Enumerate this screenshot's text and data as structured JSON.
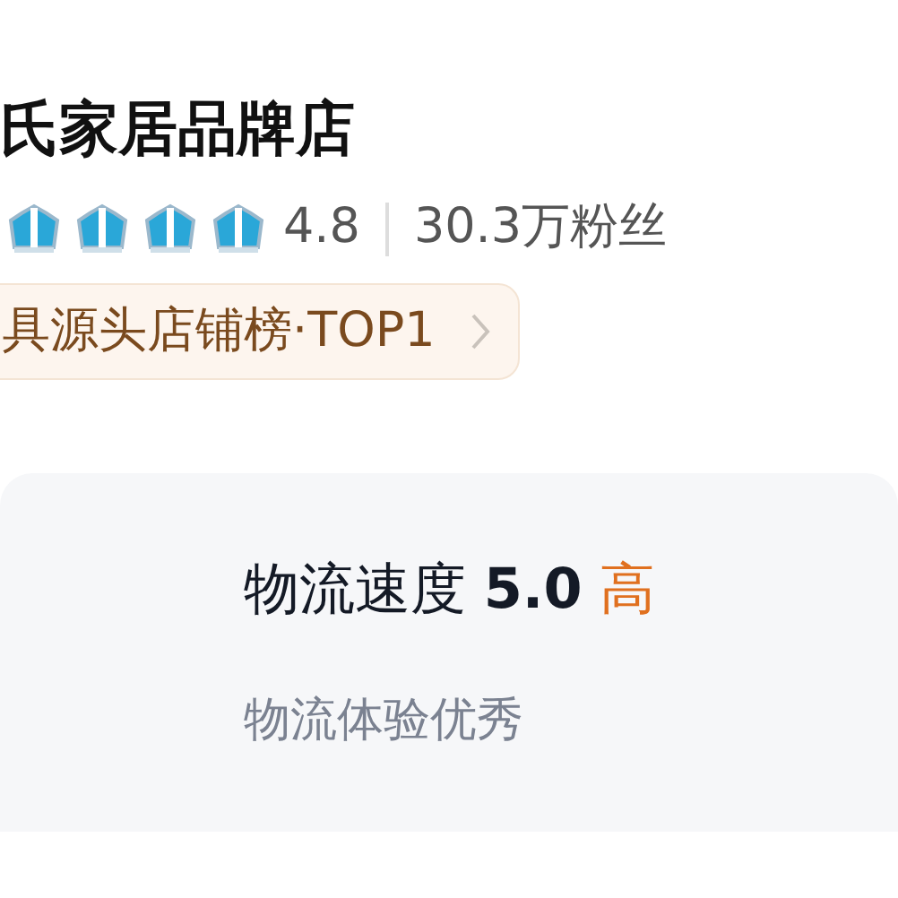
{
  "shop": {
    "name": "氏家居品牌店",
    "stars": 4,
    "rating": "4.8",
    "followers": "30.3万粉丝",
    "rank_badge": "具源头店铺榜·TOP1"
  },
  "score": {
    "label": "物流速度",
    "value": "5.0",
    "level_text": "高",
    "note": "物流体验优秀"
  }
}
